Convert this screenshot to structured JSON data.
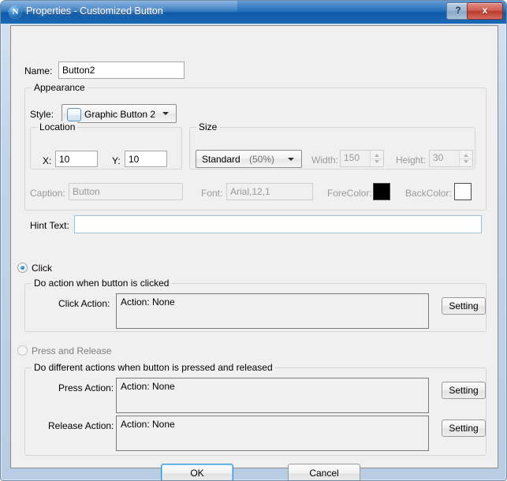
{
  "window": {
    "title": "Properties - Customized Button",
    "icon": "n-logo-icon",
    "help_label": "?",
    "close_label": "x"
  },
  "form": {
    "name_label": "Name:",
    "name_value": "Button2",
    "appearance_group": "Appearance",
    "style_label": "Style:",
    "style_value": "Graphic Button 2",
    "location_group": "Location",
    "x_label": "X:",
    "x_value": "10",
    "y_label": "Y:",
    "y_value": "10",
    "size_group": "Size",
    "size_value": "Standard",
    "size_percent": "(50%)",
    "width_label": "Width:",
    "width_value": "150",
    "height_label": "Height:",
    "height_value": "30",
    "caption_label": "Caption:",
    "caption_value": "Button",
    "font_label": "Font:",
    "font_value": "Arial,12,1",
    "forecolor_label": "ForeColor:",
    "forecolor_value": "#000000",
    "backcolor_label": "BackColor:",
    "backcolor_value": "#ffffff",
    "hint_label": "Hint Text:",
    "hint_value": "",
    "hint_placeholder": ""
  },
  "click_section": {
    "radio_label": "Click",
    "group_title": "Do action when button is clicked",
    "action_label": "Click Action:",
    "action_value": "Action: None",
    "setting_label": "Setting"
  },
  "press_release_section": {
    "radio_label": "Press and Release",
    "group_title": "Do different actions when button is pressed and released",
    "press_label": "Press Action:",
    "press_value": "Action: None",
    "press_setting_label": "Setting",
    "release_label": "Release Action:",
    "release_value": "Action: None",
    "release_setting_label": "Setting"
  },
  "footer": {
    "ok_label": "OK",
    "cancel_label": "Cancel"
  }
}
